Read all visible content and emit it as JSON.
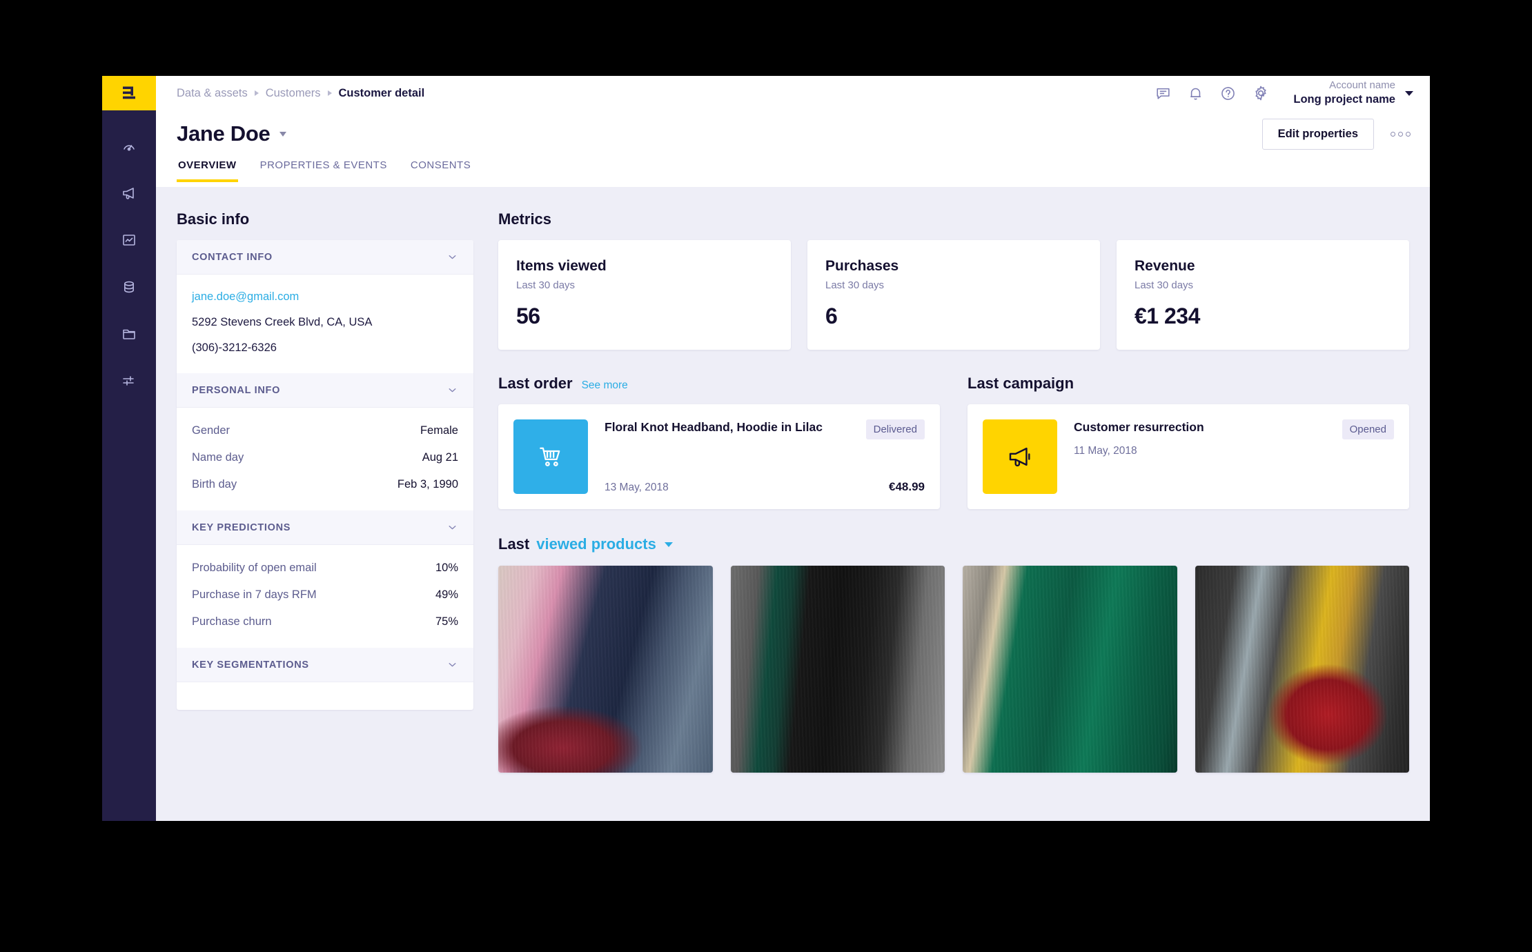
{
  "brand": {
    "logo_glyph": "E",
    "logo_bg": "#ffd400",
    "sidebar_bg": "#241f47",
    "accent_yellow": "#ffd400",
    "accent_blue": "#2bade4"
  },
  "sidebar": {
    "items": [
      {
        "name": "dashboard",
        "icon": "gauge-icon"
      },
      {
        "name": "campaigns",
        "icon": "megaphone-icon"
      },
      {
        "name": "analytics",
        "icon": "chart-image-icon"
      },
      {
        "name": "data",
        "icon": "database-icon"
      },
      {
        "name": "assets",
        "icon": "folder-icon"
      },
      {
        "name": "settings",
        "icon": "sliders-icon"
      }
    ]
  },
  "topbar": {
    "breadcrumb": [
      {
        "label": "Data & assets",
        "current": false
      },
      {
        "label": "Customers",
        "current": false
      },
      {
        "label": "Customer detail",
        "current": true
      }
    ],
    "icons": [
      "chat-icon",
      "bell-icon",
      "help-icon",
      "gear-icon"
    ],
    "account_name": "Account name",
    "project_name": "Long project name"
  },
  "page": {
    "title": "Jane Doe",
    "edit_button": "Edit properties",
    "more_button": "more-options",
    "tabs": [
      {
        "label": "OVERVIEW",
        "active": true
      },
      {
        "label": "PROPERTIES & EVENTS",
        "active": false
      },
      {
        "label": "CONSENTS",
        "active": false
      }
    ]
  },
  "basic_info": {
    "heading": "Basic info",
    "sections": [
      {
        "label": "CONTACT INFO",
        "type": "lines",
        "lines": [
          {
            "text": "jane.doe@gmail.com",
            "link": true
          },
          {
            "text": "5292 Stevens Creek Blvd, CA, USA",
            "link": false
          },
          {
            "text": "(306)-3212-6326",
            "link": false
          }
        ]
      },
      {
        "label": "PERSONAL INFO",
        "type": "kv",
        "rows": [
          {
            "key": "Gender",
            "value": "Female"
          },
          {
            "key": "Name day",
            "value": "Aug 21"
          },
          {
            "key": "Birth day",
            "value": "Feb 3, 1990"
          }
        ]
      },
      {
        "label": "KEY PREDICTIONS",
        "type": "kv",
        "rows": [
          {
            "key": "Probability of open email",
            "value": "10%"
          },
          {
            "key": "Purchase in 7 days RFM",
            "value": "49%"
          },
          {
            "key": "Purchase churn",
            "value": "75%"
          }
        ]
      },
      {
        "label": "KEY SEGMENTATIONS",
        "type": "collapsed",
        "rows": []
      }
    ]
  },
  "metrics": {
    "heading": "Metrics",
    "cards": [
      {
        "title": "Items viewed",
        "subtitle": "Last 30 days",
        "value": "56"
      },
      {
        "title": "Purchases",
        "subtitle": "Last 30 days",
        "value": "6"
      },
      {
        "title": "Revenue",
        "subtitle": "Last 30 days",
        "value": "€1 234"
      }
    ]
  },
  "last_order": {
    "heading": "Last order",
    "see_more": "See more",
    "icon": "shopping-cart-icon",
    "name": "Floral Knot Headband, Hoodie in Lilac",
    "status": "Delivered",
    "date": "13 May, 2018",
    "price": "€48.99"
  },
  "last_campaign": {
    "heading": "Last campaign",
    "icon": "megaphone-icon",
    "name": "Customer resurrection",
    "status": "Opened",
    "date": "11 May, 2018"
  },
  "last_viewed": {
    "word_static": "Last",
    "word_dropdown": "viewed products",
    "products": [
      {
        "alt": "woman in pink coat with red round bag"
      },
      {
        "alt": "black leather skirt with clutch bag"
      },
      {
        "alt": "green faux fur coat"
      },
      {
        "alt": "woman in yellow top with red moschino bag"
      }
    ]
  }
}
